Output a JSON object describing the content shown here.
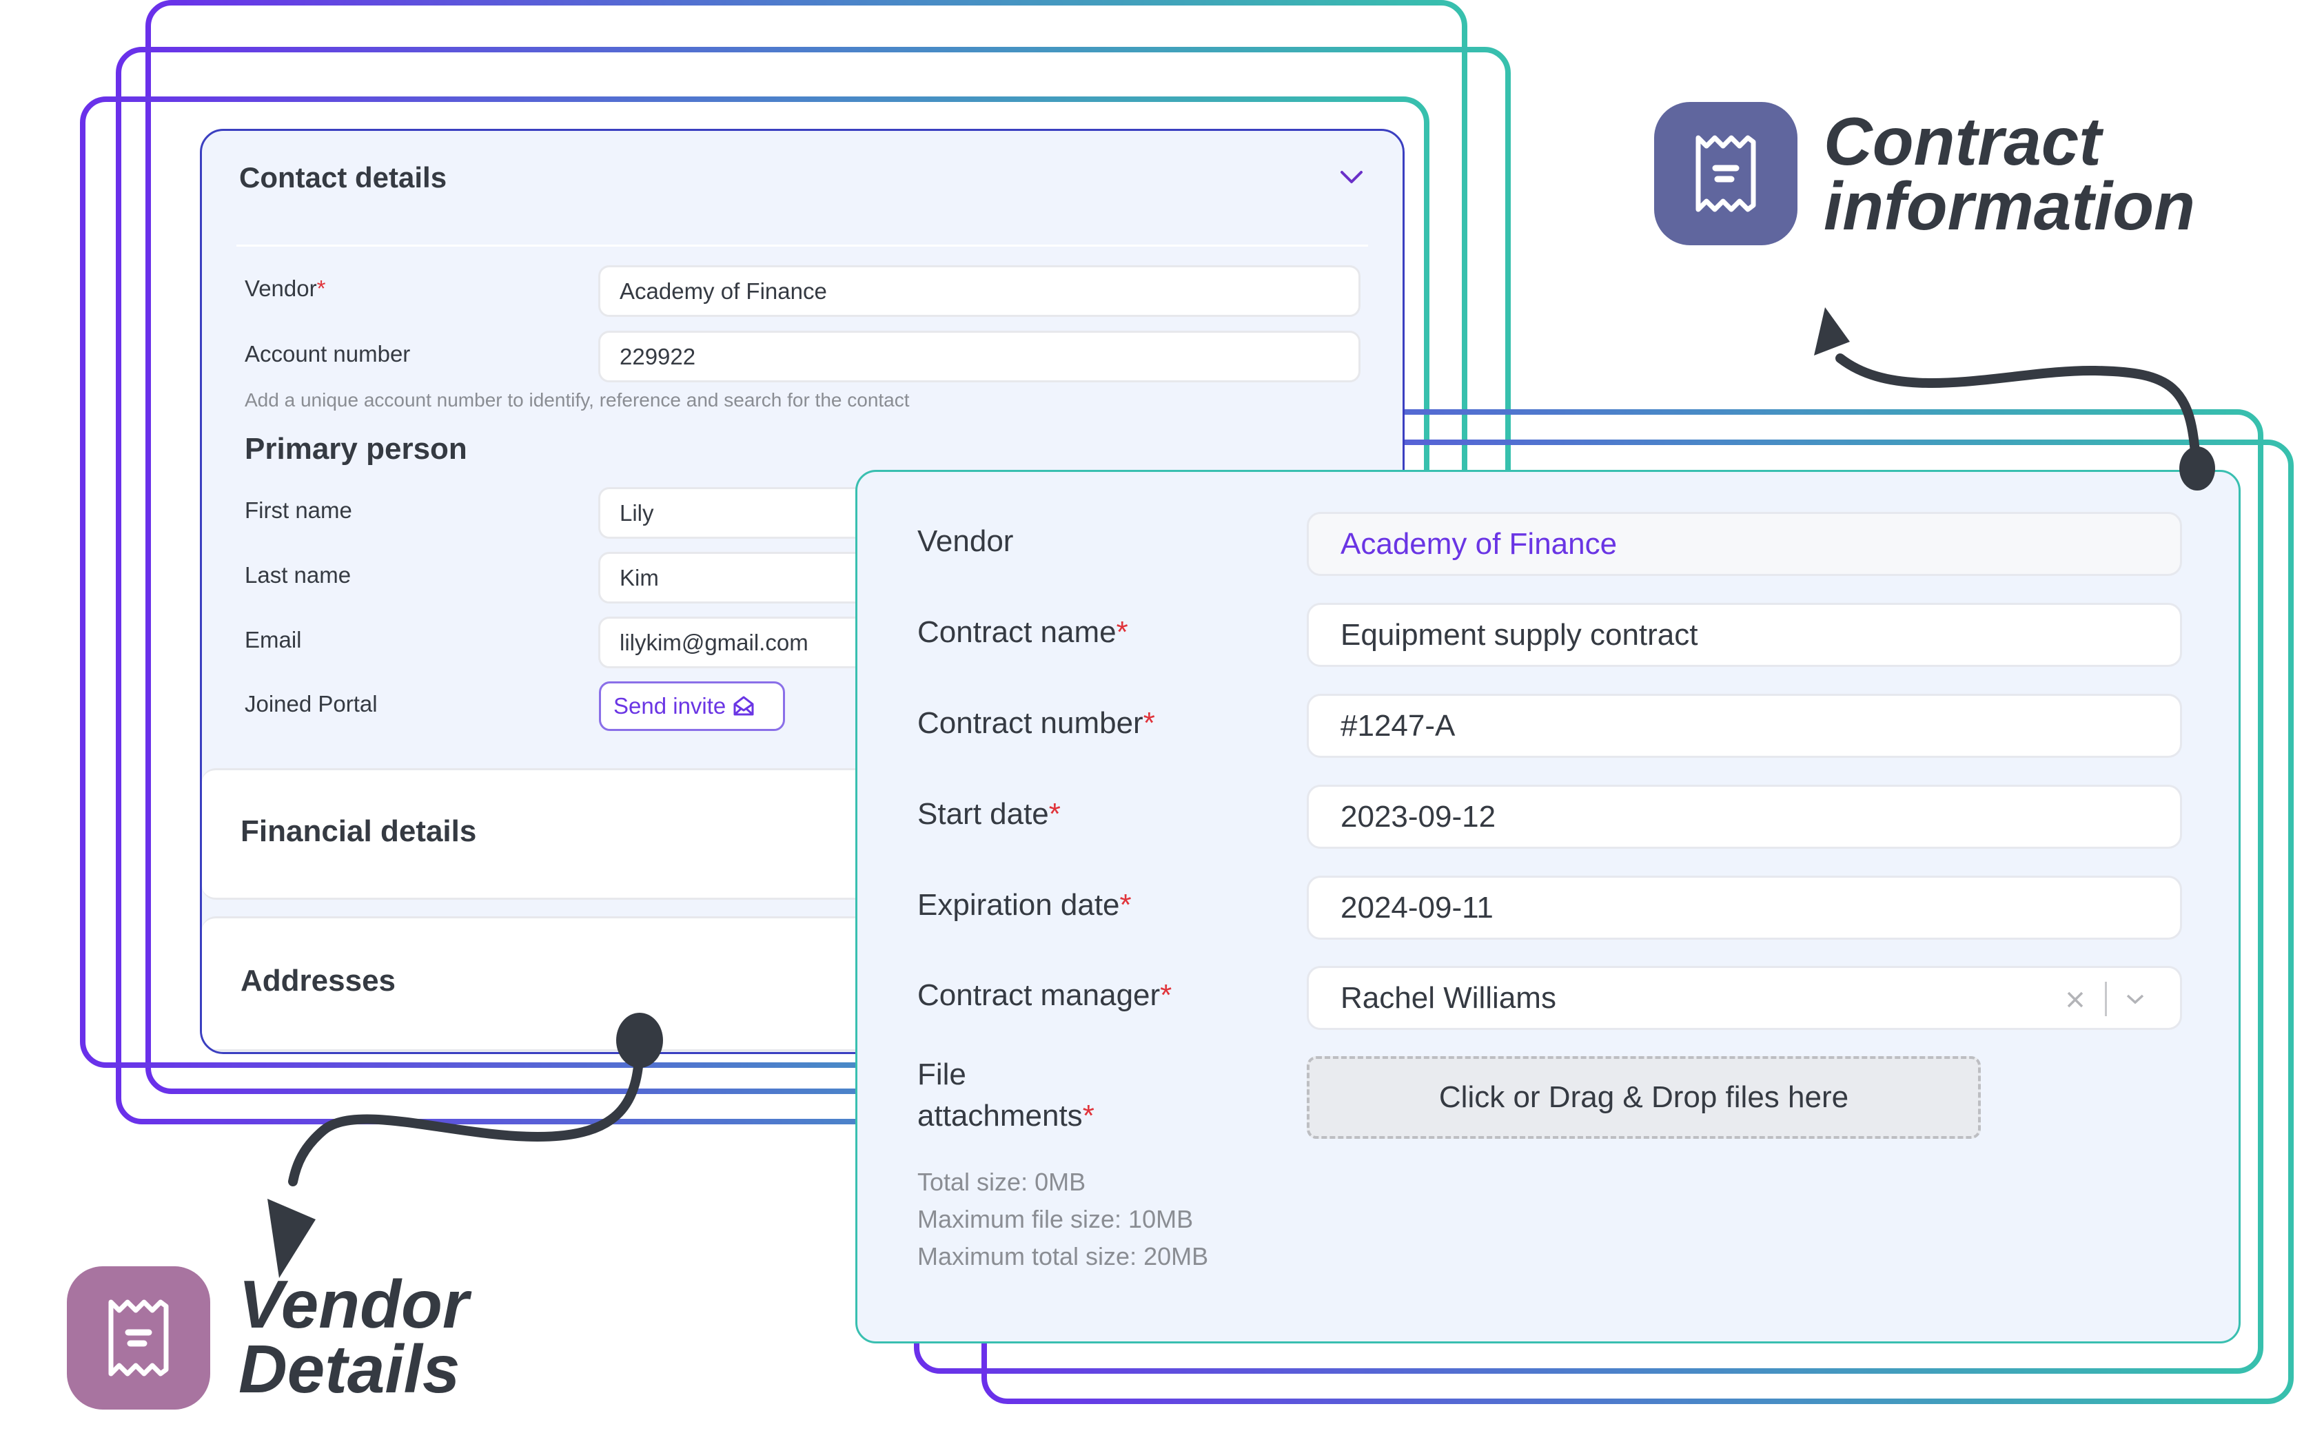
{
  "contact_card": {
    "title": "Contact details",
    "fields": [
      {
        "label": "Vendor",
        "required": true,
        "value": "Academy of Finance"
      },
      {
        "label": "Account number",
        "required": false,
        "value": "229922"
      }
    ],
    "account_hint": "Add a unique account number to identify, reference and search for the contact",
    "primary_person": {
      "heading": "Primary person",
      "fields": [
        {
          "label": "First name",
          "value": "Lily"
        },
        {
          "label": "Last name",
          "value": "Kim"
        },
        {
          "label": "Email",
          "value": "lilykim@gmail.com"
        }
      ],
      "joined_portal_label": "Joined Portal",
      "send_invite_label": "Send invite"
    },
    "sections": [
      "Financial details",
      "Addresses"
    ]
  },
  "contract_panel": {
    "fields": [
      {
        "label": "Vendor",
        "required": false,
        "value": "Academy of Finance",
        "readonly": true
      },
      {
        "label": "Contract name",
        "required": true,
        "value": "Equipment supply contract"
      },
      {
        "label": "Contract number",
        "required": true,
        "value": "#1247-A"
      },
      {
        "label": "Start date",
        "required": true,
        "value": "2023-09-12"
      },
      {
        "label": "Expiration date",
        "required": true,
        "value": "2024-09-11"
      },
      {
        "label": "Contract manager",
        "required": true,
        "value": "Rachel Williams"
      }
    ],
    "file_label_line1": "File",
    "file_label_line2": "attachments",
    "dropzone_text": "Click or Drag & Drop files here",
    "total_size": "Total size: 0MB",
    "max_file_size": "Maximum file size: 10MB",
    "max_total_size": "Maximum total size: 20MB"
  },
  "callouts": {
    "contract": {
      "line1": "Contract",
      "line2": "information",
      "icon": "receipt-icon",
      "color": "#60669e"
    },
    "vendor": {
      "line1": "Vendor",
      "line2": "Details",
      "icon": "receipt-icon",
      "color": "#a874a0"
    }
  },
  "colors": {
    "accent_purple": "#6a35e4",
    "accent_teal": "#39bfb0",
    "required": "#e0343b",
    "text": "#353a42"
  },
  "required_marker": "*"
}
